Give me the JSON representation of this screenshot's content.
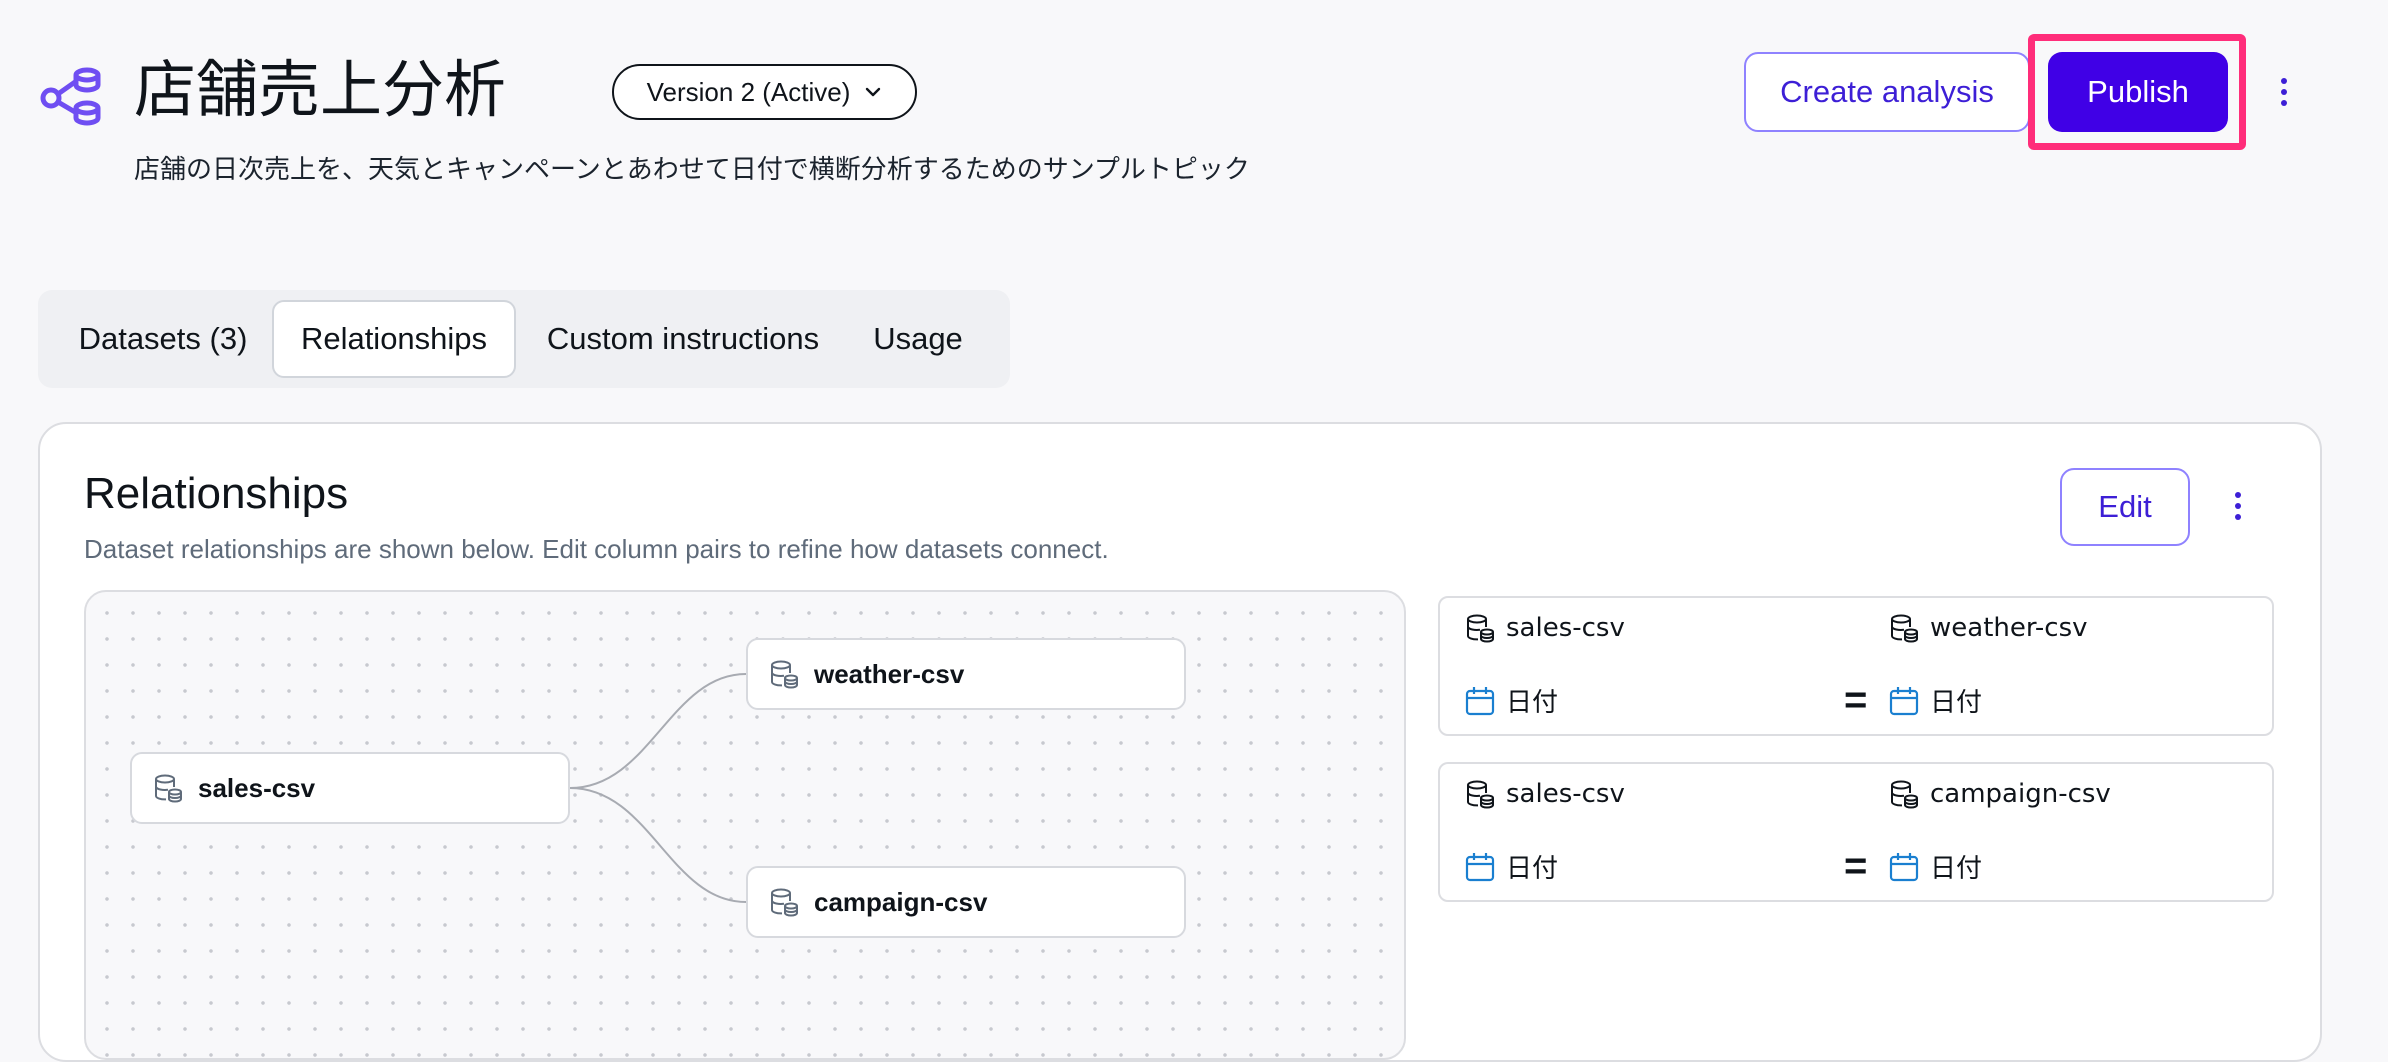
{
  "header": {
    "title": "店舗売上分析",
    "description": "店舗の日次売上を、天気とキャンペーンとあわせて日付で横断分析するためのサンプルトピック",
    "version_label": "Version 2 (Active)",
    "create_analysis_label": "Create analysis",
    "publish_label": "Publish"
  },
  "tabs": [
    {
      "label": "Datasets (3)",
      "active": false
    },
    {
      "label": "Relationships",
      "active": true
    },
    {
      "label": "Custom instructions",
      "active": false
    },
    {
      "label": "Usage",
      "active": false
    }
  ],
  "relationships": {
    "title": "Relationships",
    "description": "Dataset relationships are shown below. Edit column pairs to refine how datasets connect.",
    "edit_label": "Edit",
    "nodes": {
      "source": "sales-csv",
      "target_1": "weather-csv",
      "target_2": "campaign-csv"
    },
    "pairs": [
      {
        "left_dataset": "sales-csv",
        "left_column": "日付",
        "operator": "=",
        "right_dataset": "weather-csv",
        "right_column": "日付"
      },
      {
        "left_dataset": "sales-csv",
        "left_column": "日付",
        "operator": "=",
        "right_dataset": "campaign-csv",
        "right_column": "日付"
      }
    ]
  },
  "colors": {
    "accent": "#4000e6",
    "accent_text": "#3d1fd6",
    "highlight": "#ff2d7a",
    "topic_icon": "#6f4ef2",
    "calendar_icon": "#1a7fd0"
  }
}
